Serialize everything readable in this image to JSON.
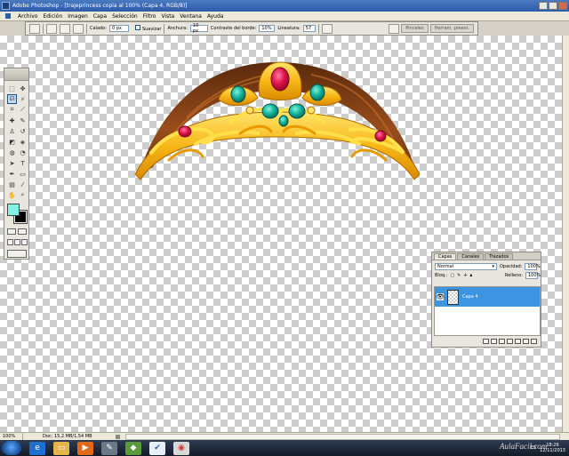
{
  "window": {
    "title": "Adobe Photoshop - [trajeprincess copia al 100% (Capa 4, RGB/8)]"
  },
  "menu": {
    "items": [
      "Archivo",
      "Edición",
      "Imagen",
      "Capa",
      "Selección",
      "Filtro",
      "Vista",
      "Ventana",
      "Ayuda"
    ]
  },
  "options": {
    "calado_label": "Calado:",
    "calado_value": "0 px",
    "suavizar_label": "Suavizar",
    "anchura_label": "Anchura:",
    "anchura_value": "10 px",
    "contraste_label": "Contraste del borde:",
    "contraste_value": "10%",
    "lineatura_label": "Lineatura:",
    "lineatura_value": "57",
    "well_tabs": [
      "Pinceles",
      "Herram. preest."
    ]
  },
  "colors": {
    "foreground": "#7ff3e4",
    "background": "#000000",
    "layer_highlight": "#3d95e2"
  },
  "layers": {
    "tabs": [
      "Capas",
      "Canales",
      "Trazados"
    ],
    "blend_mode": "Normal",
    "opacity_label": "Opacidad:",
    "opacity_value": "100%",
    "lock_label": "Bloq.:",
    "fill_label": "Relleno:",
    "fill_value": "100%",
    "items": [
      {
        "name": "Capa 4",
        "visible": true,
        "selected": true
      }
    ]
  },
  "status": {
    "zoom": "100%",
    "doc": "Doc: 15,2 MB/1,54 MB"
  },
  "taskbar": {
    "language": "ES",
    "time": "18:26",
    "date": "12/11/2013"
  },
  "watermark": "AulaFacil.com"
}
